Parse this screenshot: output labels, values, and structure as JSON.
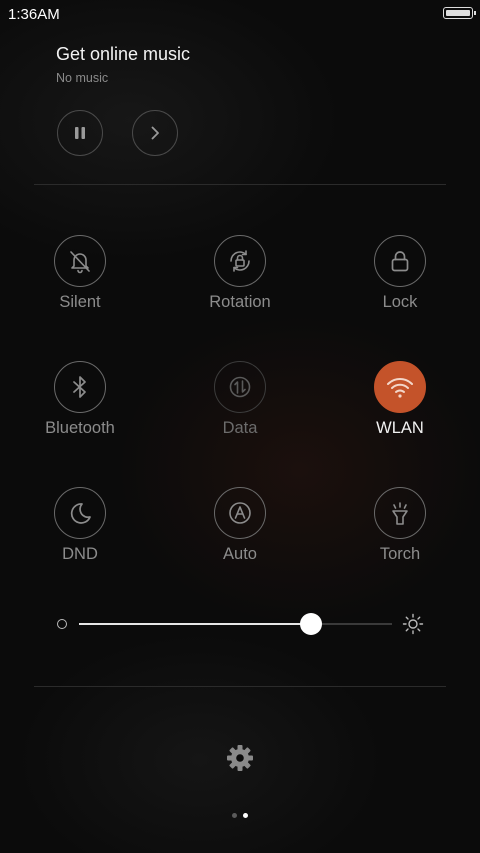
{
  "status_bar": {
    "time": "1:36AM"
  },
  "music": {
    "title": "Get online music",
    "subtitle": "No music"
  },
  "toggles": [
    {
      "label": "Silent",
      "icon": "bell-off-icon",
      "state": "off"
    },
    {
      "label": "Rotation",
      "icon": "rotation-lock-icon",
      "state": "off"
    },
    {
      "label": "Lock",
      "icon": "lock-icon",
      "state": "off"
    },
    {
      "label": "Bluetooth",
      "icon": "bluetooth-icon",
      "state": "off"
    },
    {
      "label": "Data",
      "icon": "data-arrows-icon",
      "state": "disabled"
    },
    {
      "label": "WLAN",
      "icon": "wifi-icon",
      "state": "on"
    },
    {
      "label": "DND",
      "icon": "moon-icon",
      "state": "off"
    },
    {
      "label": "Auto",
      "icon": "auto-brightness-icon",
      "state": "off"
    },
    {
      "label": "Torch",
      "icon": "flashlight-icon",
      "state": "off"
    }
  ],
  "brightness": {
    "level": 0.74
  },
  "pager": {
    "pages": 2,
    "current": 2
  },
  "colors": {
    "accent": "#c4532a",
    "background": "#0b0b0b"
  }
}
